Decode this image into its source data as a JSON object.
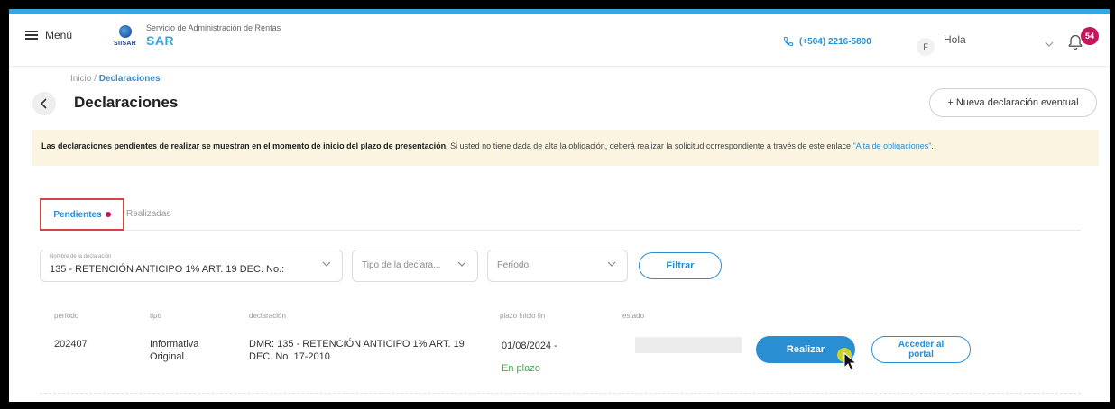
{
  "header": {
    "menu_label": "Menú",
    "logo_abbr": "SIISAR",
    "logo_subtitle": "Servicio de Administración de Rentas",
    "logo_name": "SAR",
    "phone": "(+504) 2216-5800",
    "avatar_initial": "F",
    "greeting": "Hola",
    "notifications_count": "54"
  },
  "breadcrumb": {
    "home": "Inicio",
    "separator": " / ",
    "current": "Declaraciones"
  },
  "page": {
    "title": "Declaraciones",
    "new_button": "+ Nueva declaración eventual"
  },
  "notice": {
    "bold": "Las declaraciones pendientes de realizar se muestran en el momento de inicio del plazo de presentación.",
    "text": " Si usted no tiene dada de alta la obligación, deberá realizar la solicitud correspondiente a través de este enlace ",
    "link": "\"Alta de obligaciones\"",
    "end": "."
  },
  "tabs": {
    "active": "Pendientes",
    "other": "Realizadas"
  },
  "filters": {
    "declaration_label": "Nombre de la declaración",
    "declaration_value": "135 - RETENCIÓN ANTICIPO 1% ART. 19 DEC. No.:",
    "type_placeholder": "Tipo de la declara...",
    "period_placeholder": "Período",
    "filter_button": "Filtrar"
  },
  "table": {
    "headers": [
      "período",
      "tipo",
      "declaración",
      "plazo inicio fin",
      "estado"
    ],
    "rows": [
      {
        "periodo": "202407",
        "tipo_line1": "Informativa",
        "tipo_line2": "Original",
        "declaracion_line1": "DMR: 135 - RETENCIÓN ANTICIPO 1% ART. 19",
        "declaracion_line2": "DEC. No. 17-2010",
        "plazo": "01/08/2024 -",
        "plazo_status": "En plazo",
        "action_primary": "Realizar",
        "action_secondary_line1": "Acceder al",
        "action_secondary_line2": "portal"
      }
    ]
  },
  "colors": {
    "accent": "#2a8ed2",
    "badge": "#c2185b",
    "notice_bg": "#fbf4e0",
    "success": "#3fae49",
    "highlight": "#d64545"
  }
}
